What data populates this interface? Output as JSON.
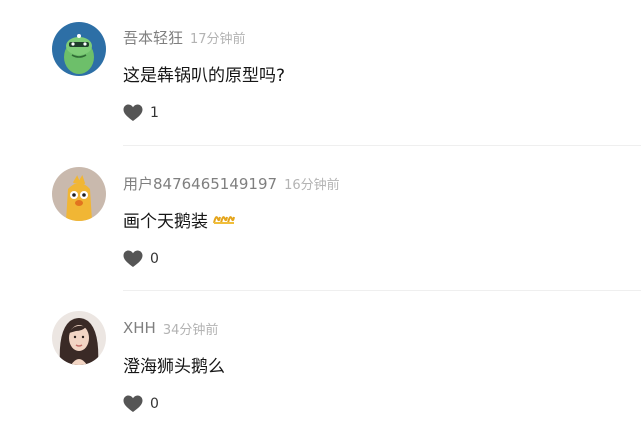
{
  "comments": [
    {
      "username": "吾本轻狂",
      "time": "17分钟前",
      "text": "这是犇锅叭的原型吗?",
      "likes": "1",
      "avatar_icon": "green-dino-avatar"
    },
    {
      "username": "用户8476465149197",
      "time": "16分钟前",
      "text": "画个天鹅装",
      "emoji": "wave-emoji",
      "likes": "0",
      "avatar_icon": "yellow-chick-avatar"
    },
    {
      "username": "XHH",
      "time": "34分钟前",
      "text": "澄海狮头鹅么",
      "likes": "0",
      "avatar_icon": "woman-portrait-avatar"
    }
  ],
  "colors": {
    "username": "#7f7f7f",
    "time": "#b3b3b3",
    "text": "#161616",
    "divider": "#efefef",
    "heart": "#555555"
  }
}
